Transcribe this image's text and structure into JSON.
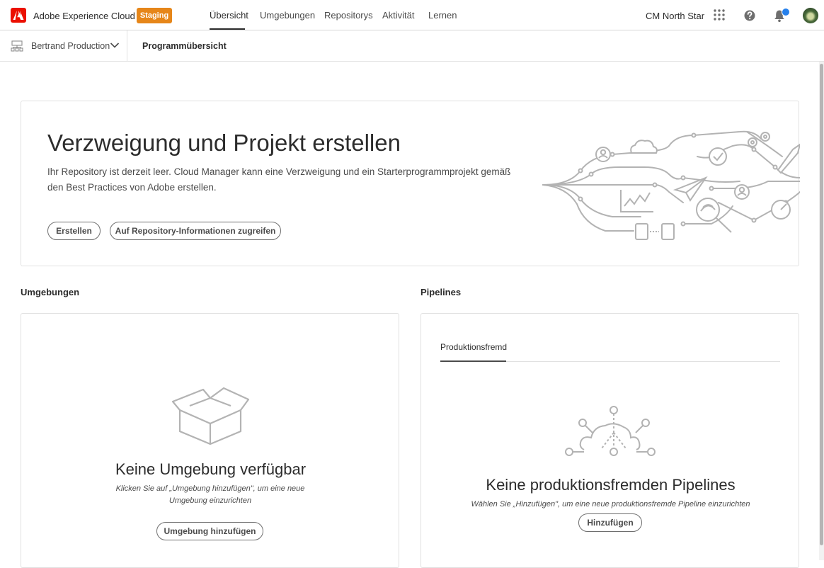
{
  "header": {
    "app_name": "Adobe Experience Cloud",
    "env_badge": "Staging",
    "nav": [
      "Übersicht",
      "Umgebungen",
      "Repositorys",
      "Aktivität",
      "Lernen"
    ],
    "active_nav": "Übersicht",
    "org_name": "CM North Star",
    "icons": [
      "apps-grid-icon",
      "help-icon",
      "bell-icon",
      "avatar"
    ],
    "accent_color": "#eb1000",
    "badge_color": "#e68619",
    "notification_dot_color": "#2680eb"
  },
  "subheader": {
    "program_name": "Bertrand Production",
    "breadcrumb": "Programmübersicht"
  },
  "hero": {
    "title": "Verzweigung und Projekt erstellen",
    "description": "Ihr Repository ist derzeit leer. Cloud Manager kann eine Verzweigung und ein Starterprogrammprojekt gemäß den Best Practices von Adobe erstellen.",
    "create_button": "Erstellen",
    "repo_info_button": "Auf Repository-Informationen zugreifen"
  },
  "environments": {
    "section_title": "Umgebungen",
    "empty_title": "Keine Umgebung verfügbar",
    "empty_hint": "Klicken Sie auf „Umgebung hinzufügen\", um eine neue Umgebung einzurichten",
    "add_button": "Umgebung hinzufügen"
  },
  "pipelines": {
    "section_title": "Pipelines",
    "tab": "Produktionsfremd",
    "empty_title": "Keine produktionsfremden Pipelines",
    "empty_hint": "Wählen Sie „Hinzufügen\", um eine neue produktionsfremde Pipeline einzurichten",
    "add_button": "Hinzufügen"
  }
}
